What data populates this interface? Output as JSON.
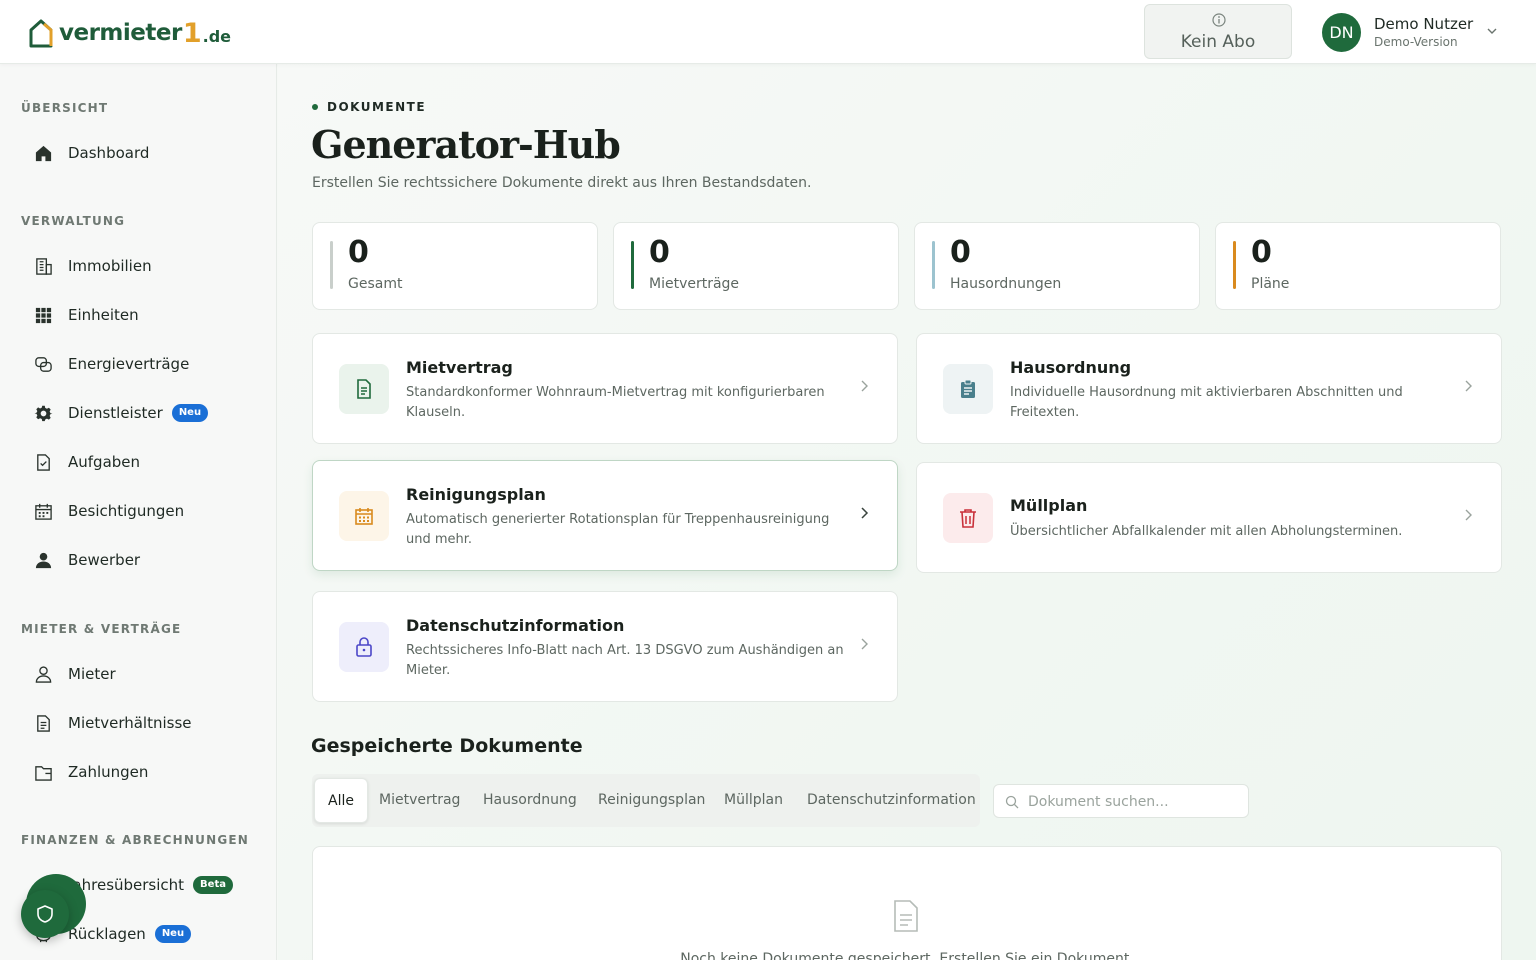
{
  "header": {
    "logo": {
      "name": "vermieter",
      "one": "1",
      "tld": ".de"
    },
    "subscription": {
      "label": "Kein Abo",
      "icon": "info-icon"
    },
    "user": {
      "initials": "DN",
      "name": "Demo Nutzer",
      "subtitle": "Demo-Version",
      "icon": "chevron-down-icon"
    }
  },
  "sidebar": {
    "sections": [
      {
        "title": "ÜBERSICHT"
      },
      {
        "title": "VERWALTUNG"
      },
      {
        "title": "MIETER & VERTRÄGE"
      },
      {
        "title": "FINANZEN & ABRECHNUNGEN"
      }
    ],
    "items": [
      {
        "label": "Dashboard",
        "icon": "home-icon"
      },
      {
        "label": "Immobilien",
        "icon": "building-icon"
      },
      {
        "label": "Einheiten",
        "icon": "grid-icon"
      },
      {
        "label": "Energieverträge",
        "icon": "energy-contract-icon"
      },
      {
        "label": "Dienstleister",
        "icon": "gear-icon",
        "badge": "Neu"
      },
      {
        "label": "Aufgaben",
        "icon": "task-icon"
      },
      {
        "label": "Besichtigungen",
        "icon": "calendar-icon"
      },
      {
        "label": "Bewerber",
        "icon": "user-filled-icon"
      },
      {
        "label": "Mieter",
        "icon": "user-outline-icon"
      },
      {
        "label": "Mietverhältnisse",
        "icon": "document-icon"
      },
      {
        "label": "Zahlungen",
        "icon": "wallet-icon"
      },
      {
        "label": "Jahresübersicht",
        "icon": "chart-icon",
        "badge": "Beta"
      },
      {
        "label": "Rücklagen",
        "icon": "piggy-bank-icon",
        "badge": "Neu"
      }
    ],
    "fab_icon": "shield-icon"
  },
  "main": {
    "eyebrow": "DOKUMENTE",
    "title": "Generator-Hub",
    "subtitle": "Erstellen Sie rechtssichere Dokumente direkt aus Ihren Bestandsdaten.",
    "stats": [
      {
        "value": "0",
        "label": "Gesamt",
        "color": "#c9cfcb"
      },
      {
        "value": "0",
        "label": "Mietverträge",
        "color": "#1f6a3c"
      },
      {
        "value": "0",
        "label": "Hausordnungen",
        "color": "#9cc3cf"
      },
      {
        "value": "0",
        "label": "Pläne",
        "color": "#d98a1e"
      }
    ],
    "generators": [
      {
        "title": "Mietvertrag",
        "description": "Standardkonformer Wohnraum-Mietvertrag mit konfigurierbaren Klauseln.",
        "icon": "document-icon",
        "accent": "#1f6a3c"
      },
      {
        "title": "Hausordnung",
        "description": "Individuelle Hausordnung mit aktivierbaren Abschnitten und Freitexten.",
        "icon": "clipboard-icon",
        "accent": "#4a7f8c"
      },
      {
        "title": "Reinigungsplan",
        "description": "Automatisch generierter Rotationsplan für Treppenhausreinigung und mehr.",
        "icon": "calendar-icon",
        "accent": "#d98a1e"
      },
      {
        "title": "Müllplan",
        "description": "Übersichtlicher Abfallkalender mit allen Abholungsterminen.",
        "icon": "trash-icon",
        "accent": "#c9303a"
      },
      {
        "title": "Datenschutzinformation",
        "description": "Rechtssicheres Info-Blatt nach Art. 13 DSGVO zum Aushändigen an Mieter.",
        "icon": "lock-icon",
        "accent": "#4b46c8"
      }
    ],
    "saved": {
      "title": "Gespeicherte Dokumente",
      "tabs": [
        "Alle",
        "Mietvertrag",
        "Hausordnung",
        "Reinigungsplan",
        "Müllplan",
        "Datenschutzinformation"
      ],
      "active_tab": "Alle",
      "search": {
        "placeholder": "Dokument suchen...",
        "value": ""
      },
      "empty_text": "Noch keine Dokumente gespeichert. Erstellen Sie ein Dokument."
    }
  }
}
